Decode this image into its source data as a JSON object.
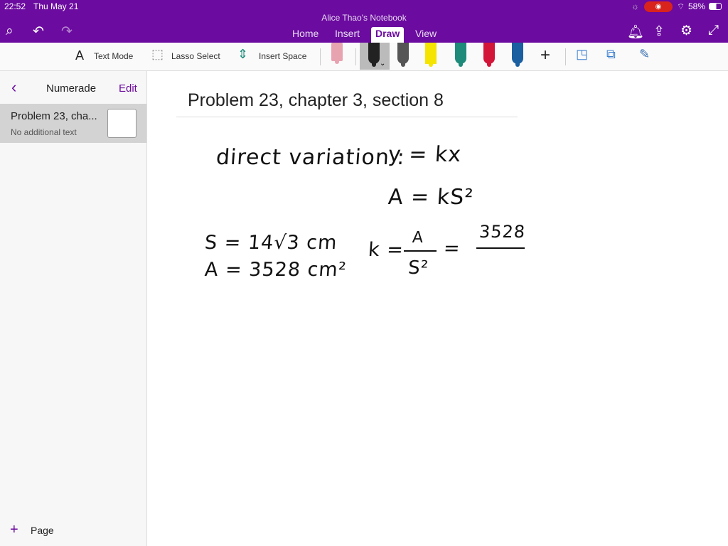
{
  "status": {
    "time": "22:52",
    "date": "Thu May 21",
    "battery": "58%"
  },
  "app": {
    "notebook_title": "Alice Thao's Notebook",
    "tabs": [
      {
        "label": "Home"
      },
      {
        "label": "Insert"
      },
      {
        "label": "Draw",
        "active": true
      },
      {
        "label": "View"
      }
    ],
    "accent": "#6b0b9f"
  },
  "toolbar": {
    "text_mode": "Text Mode",
    "lasso_select": "Lasso Select",
    "insert_space": "Insert Space",
    "add": "+",
    "pens": [
      {
        "color": "#222222",
        "selected": true
      },
      {
        "color": "#555555"
      },
      {
        "color": "#f5e400"
      },
      {
        "color": "#1e8a7a"
      },
      {
        "color": "#d3153a"
      },
      {
        "color": "#1a5fa0"
      }
    ]
  },
  "sidebar": {
    "back": "‹",
    "title": "Numerade",
    "edit": "Edit",
    "pages": [
      {
        "title": "Problem 23, cha...",
        "subtitle": "No additional text",
        "selected": true
      }
    ],
    "add_page": "Page"
  },
  "page": {
    "title": "Problem 23, chapter 3, section 8",
    "ink": {
      "line1_label": "direct variation :",
      "line1_eq": "y = kx",
      "line2_eq": "A = kS²",
      "given_s": "S = 14√3 cm",
      "given_a": "A = 3528 cm²",
      "k_lhs": "k =",
      "k_num": "A",
      "k_den": "S²",
      "k_eq": "=",
      "k_num2": "3528"
    }
  }
}
